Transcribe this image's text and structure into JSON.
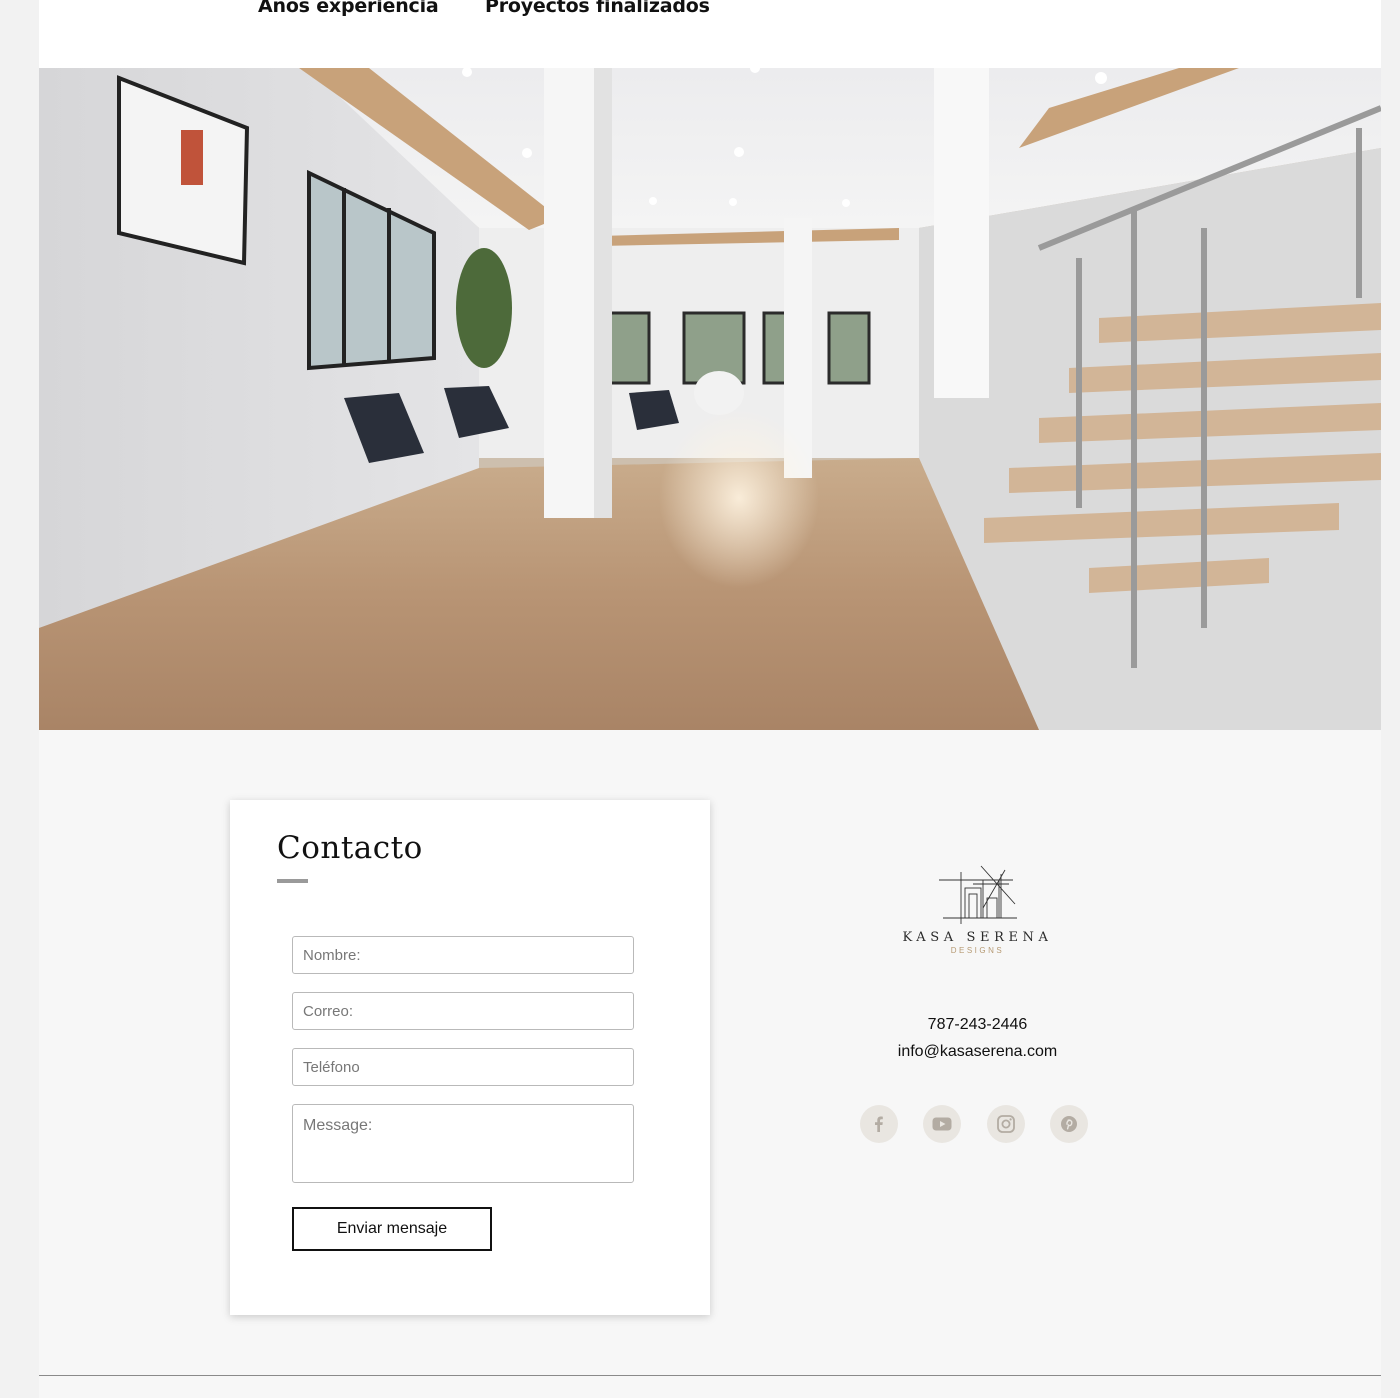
{
  "stats": {
    "years_label": "Años experiencia",
    "projects_label": "Proyectos finalizados"
  },
  "hero": {
    "image": "interior-living-room-photo"
  },
  "contact": {
    "title": "Contacto",
    "name_placeholder": "Nombre:",
    "email_placeholder": "Correo:",
    "phone_placeholder": "Teléfono",
    "message_placeholder": "Message:",
    "submit_label": "Enviar mensaje"
  },
  "brand": {
    "name": "KASA SERENA",
    "subtitle": "DESIGNS",
    "accent_color": "#b69a73"
  },
  "info": {
    "phone": "787-243-2446",
    "email": "info@kasaserena.com"
  },
  "social": [
    {
      "icon": "facebook-icon"
    },
    {
      "icon": "youtube-icon"
    },
    {
      "icon": "instagram-icon"
    },
    {
      "icon": "pinterest-icon"
    }
  ]
}
